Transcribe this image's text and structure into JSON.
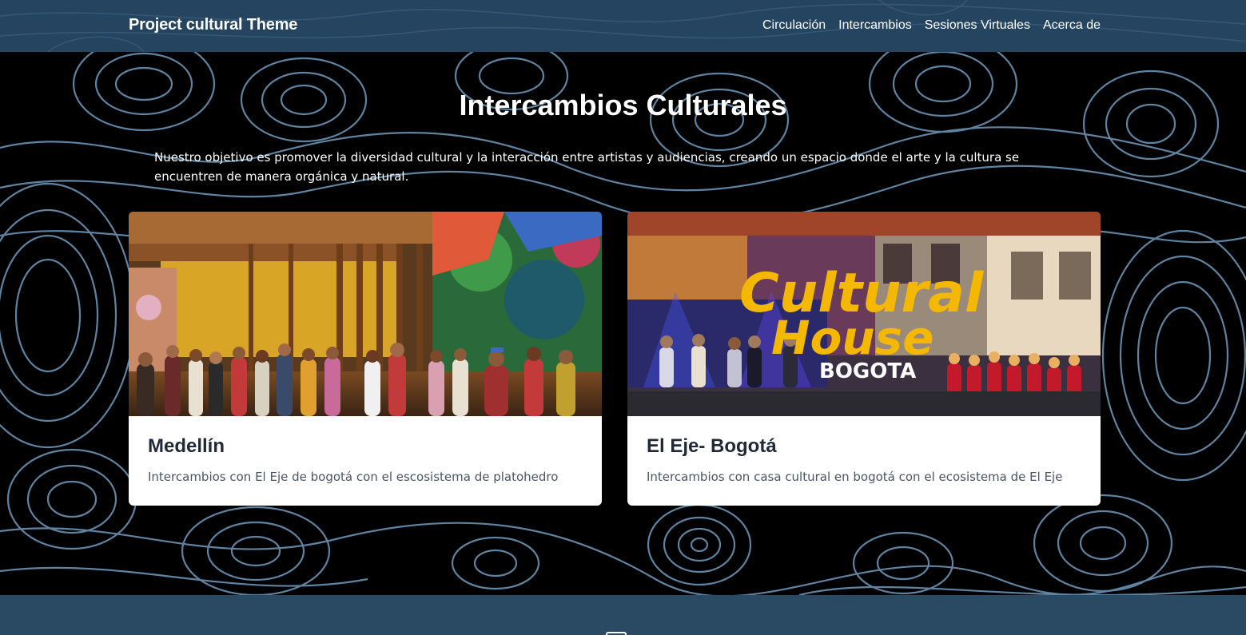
{
  "navbar": {
    "brand": "Project cultural Theme",
    "links": [
      {
        "label": "Circulación"
      },
      {
        "label": "Intercambios"
      },
      {
        "label": "Sesiones Virtuales"
      },
      {
        "label": "Acerca de"
      }
    ]
  },
  "hero": {
    "title": "Intercambios Culturales",
    "description": "Nuestro objetivo es promover la diversidad cultural y la interacción entre artistas y audiencias, creando un espacio donde el arte y la cultura se encuentren de manera orgánica y natural."
  },
  "cards": [
    {
      "title": "Medellín",
      "text": "Intercambios con El Eje de bogotá con el escosistema de platohedro"
    },
    {
      "title": "El Eje- Bogotá",
      "text": "Intercambios con casa cultural en bogotá con el ecosistema de El Eje",
      "image_logo_line1": "Cultural",
      "image_logo_line2": "House",
      "image_logo_line3": "BOGOTA"
    }
  ],
  "colors": {
    "navbar_bg": "#25445f",
    "contour_line": "#7fb0d8",
    "card_bg": "#ffffff",
    "title_text": "#1f2937",
    "body_text": "#4b5563",
    "logo_yellow": "#f5b800"
  }
}
